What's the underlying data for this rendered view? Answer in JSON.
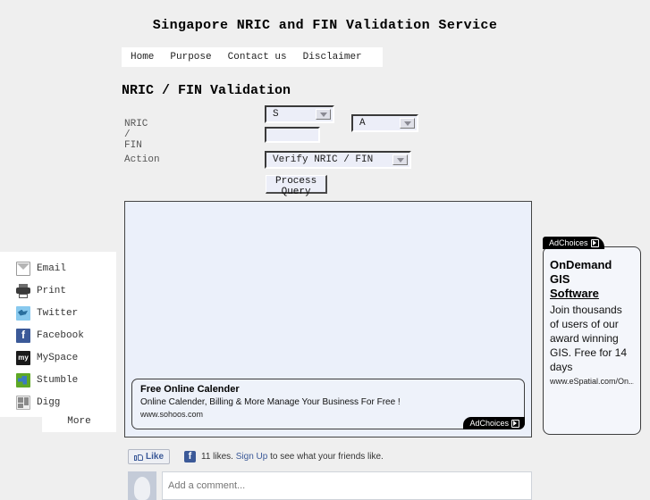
{
  "page": {
    "title": "Singapore NRIC and FIN Validation Service",
    "background_color": "#efefef"
  },
  "nav": {
    "items": [
      {
        "label": "Home"
      },
      {
        "label": "Purpose"
      },
      {
        "label": "Contact us"
      },
      {
        "label": "Disclaimer"
      }
    ]
  },
  "heading": "NRIC / FIN Validation",
  "form": {
    "nric_label": "NRIC / FIN",
    "action_label": "Action",
    "prefix_select": {
      "value": "S"
    },
    "digits_input": {
      "value": "",
      "placeholder": ""
    },
    "suffix_select": {
      "value": "A"
    },
    "action_select": {
      "value": "Verify NRIC / FIN"
    },
    "submit_button": "Process Query"
  },
  "share": {
    "items": [
      {
        "label": "Email",
        "icon": "email-icon"
      },
      {
        "label": "Print",
        "icon": "print-icon"
      },
      {
        "label": "Twitter",
        "icon": "twitter-icon"
      },
      {
        "label": "Facebook",
        "icon": "facebook-icon",
        "glyph": "f"
      },
      {
        "label": "MySpace",
        "icon": "myspace-icon",
        "glyph": "my"
      },
      {
        "label": "Stumble",
        "icon": "stumbleupon-icon"
      },
      {
        "label": "Digg",
        "icon": "digg-icon"
      }
    ],
    "more_label": "More"
  },
  "inner_ad": {
    "title": "Free Online Calender",
    "body": "Online Calender, Billing & More Manage Your Business For Free !",
    "url": "www.sohoos.com",
    "adchoices_label": "AdChoices"
  },
  "side_ad": {
    "adchoices_label": "AdChoices",
    "title_line1": "OnDemand GIS",
    "title_line2": "Software",
    "body": "Join thousands of users of our award winning GIS. Free for 14 days",
    "url": "www.eSpatial.com/On..."
  },
  "facebook": {
    "like_label": "Like",
    "f_glyph": "f",
    "likes_prefix": "11 likes.",
    "signup_label": "Sign Up",
    "likes_suffix": "to see what your friends like.",
    "comment_placeholder": "Add a comment..."
  }
}
